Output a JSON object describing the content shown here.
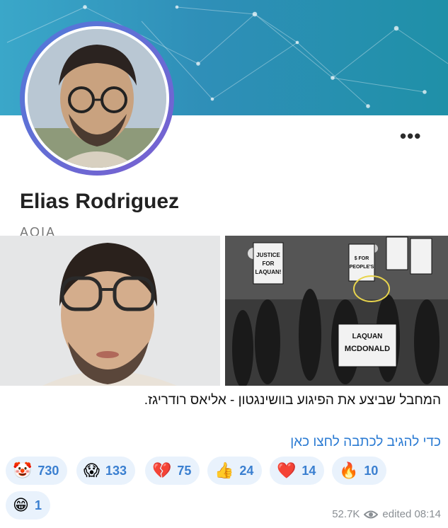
{
  "profile": {
    "name": "Elias Rodriguez",
    "subtitle": "AOIA",
    "more_label": "•••"
  },
  "post": {
    "caption": "המחבל שביצע את הפיגוע בוושינגטון - אליאס רודריגז.",
    "link_text": "כדי להגיב לכתבה לחצו כאן"
  },
  "protest_signs": {
    "sign1": "JUSTICE FOR LAQUAN! NOT $ FOR AMAZON!",
    "sign2": "$ FOR PEOPLE'S NEEDS, NOT AMAZON!",
    "sign3": "LAQUAN MCDONALD"
  },
  "reactions": [
    {
      "emoji": "🤡",
      "count": "730"
    },
    {
      "emoji": "😱",
      "count": "133"
    },
    {
      "emoji": "💔",
      "count": "75"
    },
    {
      "emoji": "👍",
      "count": "24"
    },
    {
      "emoji": "❤️",
      "count": "14"
    },
    {
      "emoji": "🔥",
      "count": "10"
    },
    {
      "emoji": "😁",
      "count": "1"
    }
  ],
  "meta": {
    "views": "52.7K",
    "edited": "edited 08:14"
  },
  "colors": {
    "banner": "#2f8fb8",
    "link": "#2b7bd3",
    "reaction_bg": "#e9f2fc",
    "reaction_text": "#3a7fd0"
  }
}
